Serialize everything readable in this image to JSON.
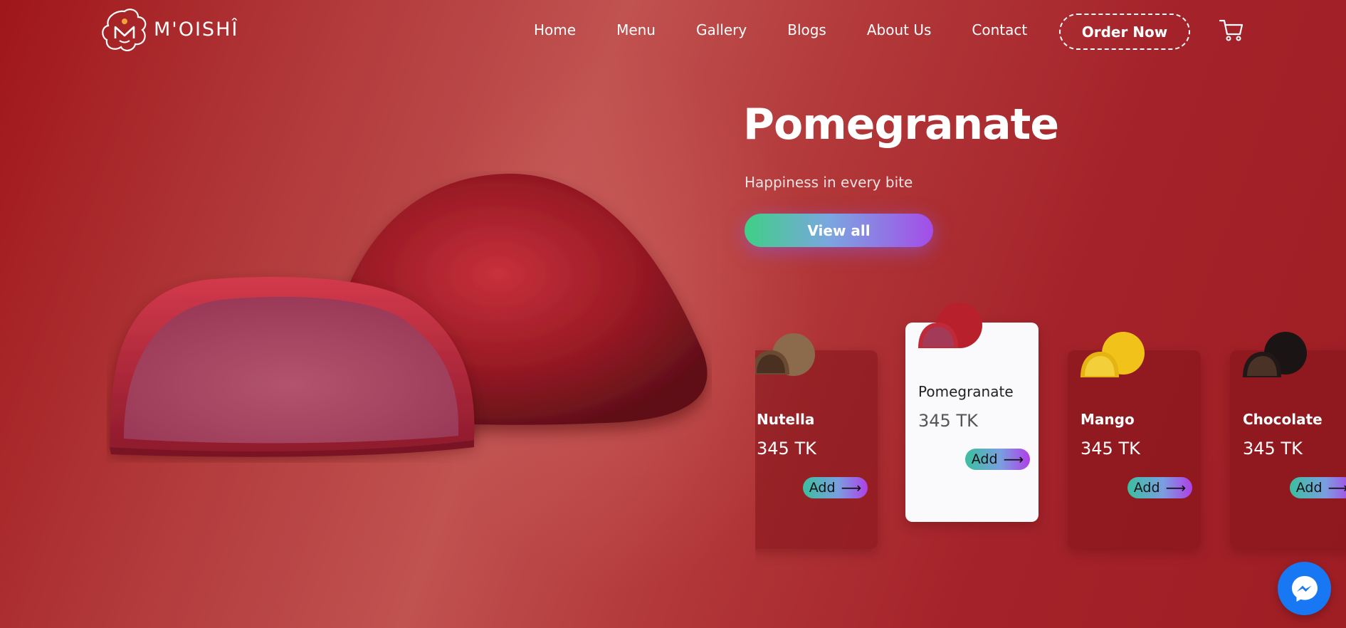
{
  "brand": {
    "name": "M'OISHÎ"
  },
  "nav": {
    "items": [
      "Home",
      "Menu",
      "Gallery",
      "Blogs",
      "About Us",
      "Contact"
    ],
    "order_label": "Order Now"
  },
  "hero": {
    "title": "Pomegranate",
    "subtitle": "Happiness in every bite",
    "cta_label": "View all"
  },
  "products": [
    {
      "name": "Nutella",
      "price": "345 TK",
      "add_label": "Add",
      "active": false
    },
    {
      "name": "Pomegranate",
      "price": "345 TK",
      "add_label": "Add",
      "active": true
    },
    {
      "name": "Mango",
      "price": "345 TK",
      "add_label": "Add",
      "active": false
    },
    {
      "name": "Chocolate",
      "price": "345 TK",
      "add_label": "Add",
      "active": false
    }
  ],
  "colors": {
    "background": "#a91f24",
    "accent_gradient_start": "#3fcf86",
    "accent_gradient_end": "#a44de8",
    "messenger": "#1877f2"
  },
  "icons": [
    "logo-icon",
    "cart-icon",
    "arrow-right-icon",
    "messenger-icon"
  ]
}
